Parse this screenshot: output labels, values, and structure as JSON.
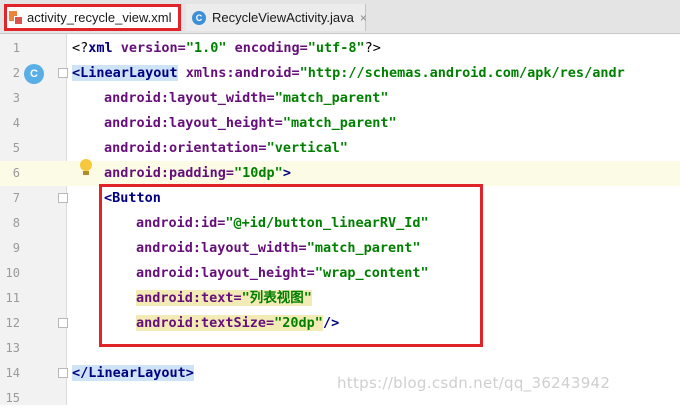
{
  "tabs": [
    {
      "label": "activity_recycle_view.xml",
      "icon": "xml-file-icon",
      "active": true
    },
    {
      "label": "RecycleViewActivity.java",
      "icon": "java-class-icon",
      "active": false
    }
  ],
  "gutter_icon_letter": "C",
  "editor": {
    "line_numbers": [
      "1",
      "2",
      "3",
      "4",
      "5",
      "6",
      "7",
      "8",
      "9",
      "10",
      "11",
      "12",
      "13",
      "14",
      "15"
    ],
    "lines": [
      {
        "pi_open": "<?",
        "pi_name": "xml",
        "a1": " version=",
        "v1": "\"1.0\"",
        "a2": " encoding=",
        "v2": "\"utf-8\"",
        "pi_close": "?>"
      },
      {
        "tag": "<LinearLayout",
        "attr": " xmlns:android=",
        "val": "\"http://schemas.android.com/apk/res/andr"
      },
      {
        "attr": "android:layout_width=",
        "val": "\"match_parent\""
      },
      {
        "attr": "android:layout_height=",
        "val": "\"match_parent\""
      },
      {
        "attr": "android:orientation=",
        "val": "\"vertical\""
      },
      {
        "attr": "android:padding=",
        "val": "\"10dp\"",
        "close": ">"
      },
      {
        "tag": "<Button"
      },
      {
        "attr": "android:id=",
        "val": "\"@+id/button_linearRV_Id\""
      },
      {
        "attr": "android:layout_width=",
        "val": "\"match_parent\""
      },
      {
        "attr": "android:layout_height=",
        "val": "\"wrap_content\""
      },
      {
        "attr": "android:text=",
        "val": "\"列表视图\""
      },
      {
        "attr": "android:textSize=",
        "val": "\"20dp\"",
        "close": "/>"
      },
      {},
      {
        "tag": "</LinearLayout>"
      },
      {}
    ]
  },
  "watermark": "https://blog.csdn.net/qq_36243942"
}
